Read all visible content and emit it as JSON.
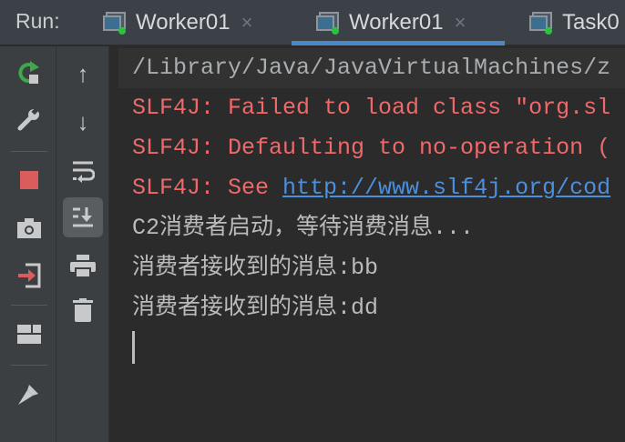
{
  "run_label": "Run:",
  "tabs": [
    {
      "label": "Worker01",
      "close": "×"
    },
    {
      "label": "Worker01",
      "close": "×",
      "active": true
    },
    {
      "label": "Task0"
    }
  ],
  "left_toolbar": [
    "rerun-icon",
    "wrench-icon",
    "stop-icon",
    "camera-icon",
    "exit-icon",
    "layout-icon",
    "pin-icon"
  ],
  "right_toolbar": [
    "up-arrow-icon",
    "down-arrow-icon",
    "soft-wrap-icon",
    "scroll-to-end-icon",
    "print-icon",
    "trash-icon"
  ],
  "console": {
    "cmd": "/Library/Java/JavaVirtualMachines/z",
    "err1": "SLF4J: Failed to load class \"org.sl",
    "err2": "SLF4J: Defaulting to no-operation (",
    "err3_prefix": "SLF4J: See ",
    "err3_link": "http://www.slf4j.org/cod",
    "out1": "C2消费者启动，等待消费消息...",
    "out2": "消费者接收到的消息:bb",
    "out3": "消费者接收到的消息:dd"
  }
}
